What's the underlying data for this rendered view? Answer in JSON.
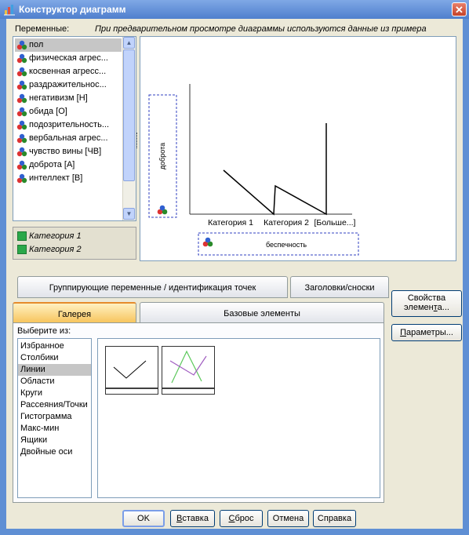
{
  "window": {
    "title": "Конструктор диаграмм",
    "close_glyph": "✕",
    "icon": "chart-builder-icon"
  },
  "variables": {
    "label": "Переменные:",
    "note": "При предварительном просмотре диаграммы используются данные из примера",
    "items": [
      {
        "label": "пол",
        "selected": true
      },
      {
        "label": "физическая агрес..."
      },
      {
        "label": "косвенная агресс..."
      },
      {
        "label": "раздражительнос..."
      },
      {
        "label": "негативизм [Н]"
      },
      {
        "label": "обида [О]"
      },
      {
        "label": "подозрительность..."
      },
      {
        "label": "вербальная агрес..."
      },
      {
        "label": "чувство вины [ЧВ]"
      },
      {
        "label": "доброта [А]"
      },
      {
        "label": "интеллект [В]"
      }
    ],
    "scroll_up": "▲",
    "scroll_down": "▼"
  },
  "categories": {
    "items": [
      "Категория 1",
      "Категория 2"
    ]
  },
  "preview": {
    "y_variable": "доброта",
    "x_variable": "беспечность",
    "x_ticks": [
      "Категория 1",
      "Категория 2",
      "[Больше...]"
    ],
    "line_values": [
      0.72,
      0.0,
      0.28,
      0.0,
      1.0
    ]
  },
  "tabs": {
    "grouping": "Группирующие переменные / идентификация точек",
    "titles": "Заголовки/сноски",
    "gallery": "Галерея",
    "basic": "Базовые элементы"
  },
  "gallery": {
    "choose_label": "Выберите из:",
    "types": [
      "Избранное",
      "Столбики",
      "Линии",
      "Области",
      "Круги",
      "Рассеяния/Точки",
      "Гистограмма",
      "Макс-мин",
      "Ящики",
      "Двойные оси"
    ],
    "selected_type": "Линии"
  },
  "side_buttons": {
    "element_props_line1": "Свойства",
    "element_props_line2_a": "элемен",
    "element_props_line2_u": "т",
    "element_props_line2_b": "а...",
    "params_u": "П",
    "params_rest": "араметры..."
  },
  "buttons": {
    "ok": "OK",
    "paste_u": "В",
    "paste_rest": "ставка",
    "reset_u": "С",
    "reset_rest": "брос",
    "cancel": "Отмена",
    "help": "Справка"
  }
}
